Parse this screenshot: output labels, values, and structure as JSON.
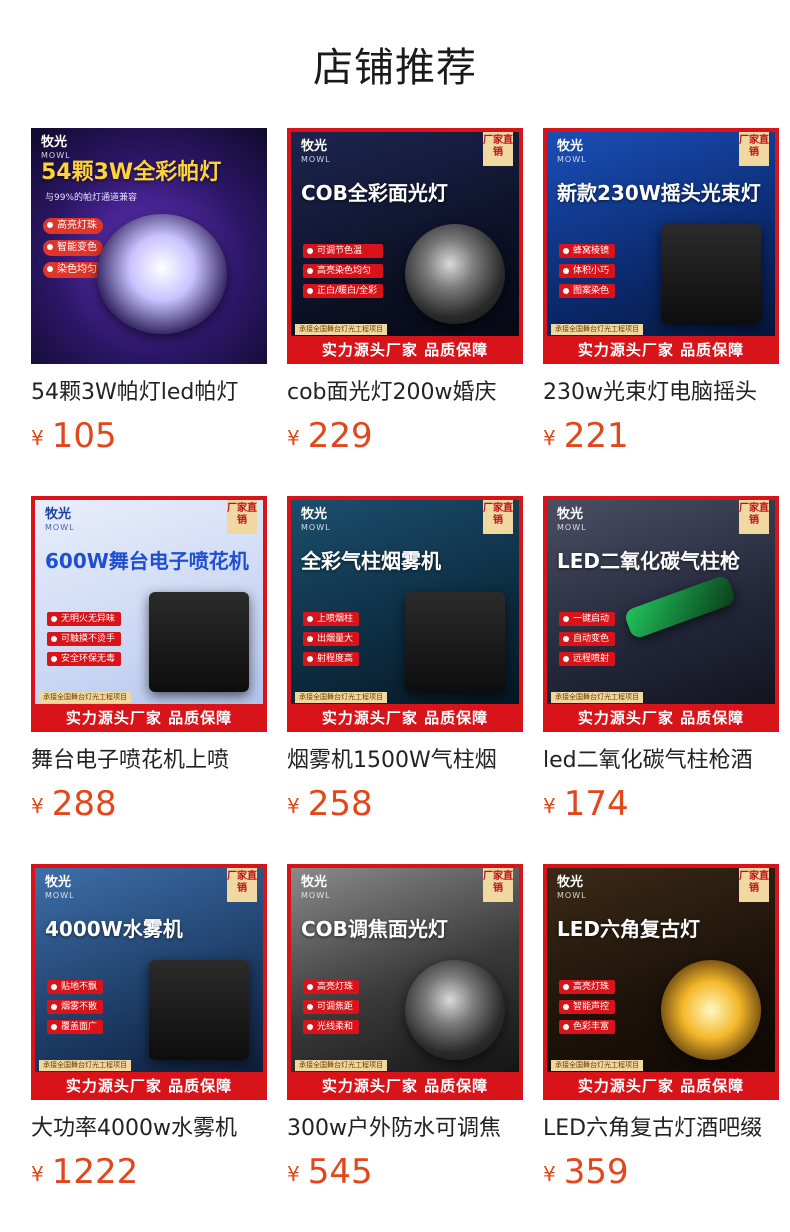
{
  "page": {
    "title": "店铺推荐"
  },
  "colors": {
    "price": "#e2471b",
    "brand_red": "#d8141a"
  },
  "products": [
    {
      "name": "54颗3W帕灯led帕灯",
      "currency": "¥",
      "price": "105",
      "image": {
        "logo": "牧光",
        "title": "54颗3W全彩帕灯",
        "subtitle": "与99%的帕灯通道兼容",
        "features": [
          "高亮灯珠",
          "智能变色",
          "染色均匀"
        ]
      }
    },
    {
      "name": "cob面光灯200w婚庆",
      "currency": "¥",
      "price": "229",
      "image": {
        "logo": "牧光",
        "tag": "厂家直销",
        "title": "COB全彩面光灯",
        "features": [
          "可调节色温",
          "高亮染色均匀",
          "正白/暖白/全彩"
        ],
        "strip_pre": "承接全国舞台灯光工程项目",
        "strip": "实力源头厂家 品质保障"
      }
    },
    {
      "name": "230w光束灯电脑摇头",
      "currency": "¥",
      "price": "221",
      "image": {
        "logo": "牧光",
        "tag": "厂家直销",
        "title": "新款230W摇头光束灯",
        "features": [
          "蜂窝棱镜",
          "体积小巧",
          "图案染色"
        ],
        "strip_pre": "承接全国舞台灯光工程项目",
        "strip": "实力源头厂家 品质保障"
      }
    },
    {
      "name": "舞台电子喷花机上喷",
      "currency": "¥",
      "price": "288",
      "image": {
        "logo": "牧光",
        "tag": "厂家直销",
        "title": "600W舞台电子喷花机",
        "features": [
          "无明火无异味",
          "可触摸不烫手",
          "安全环保无毒"
        ],
        "strip_pre": "承接全国舞台灯光工程项目",
        "strip": "实力源头厂家 品质保障"
      }
    },
    {
      "name": "烟雾机1500W气柱烟",
      "currency": "¥",
      "price": "258",
      "image": {
        "logo": "牧光",
        "tag": "厂家直销",
        "title": "全彩气柱烟雾机",
        "features": [
          "上喷烟柱",
          "出烟量大",
          "射程度高"
        ],
        "strip_pre": "承接全国舞台灯光工程项目",
        "strip": "实力源头厂家 品质保障"
      }
    },
    {
      "name": "led二氧化碳气柱枪酒",
      "currency": "¥",
      "price": "174",
      "image": {
        "logo": "牧光",
        "tag": "厂家直销",
        "title": "LED二氧化碳气柱枪",
        "features": [
          "一键启动",
          "自动变色",
          "远程喷射"
        ],
        "strip_pre": "承接全国舞台灯光工程项目",
        "strip": "实力源头厂家 品质保障"
      }
    },
    {
      "name": "大功率4000w水雾机",
      "currency": "¥",
      "price": "1222",
      "image": {
        "logo": "牧光",
        "tag": "厂家直销",
        "title": "4000W水雾机",
        "features": [
          "贴地不飘",
          "烟雾不散",
          "覆盖面广"
        ],
        "strip_pre": "承接全国舞台灯光工程项目",
        "strip": "实力源头厂家 品质保障"
      }
    },
    {
      "name": "300w户外防水可调焦",
      "currency": "¥",
      "price": "545",
      "image": {
        "logo": "牧光",
        "tag": "厂家直销",
        "title": "COB调焦面光灯",
        "features": [
          "高亮灯珠",
          "可调焦距",
          "光线柔和"
        ],
        "strip_pre": "承接全国舞台灯光工程项目",
        "strip": "实力源头厂家 品质保障"
      }
    },
    {
      "name": "LED六角复古灯酒吧缀",
      "currency": "¥",
      "price": "359",
      "image": {
        "logo": "牧光",
        "tag": "厂家直销",
        "title": "LED六角复古灯",
        "features": [
          "高亮灯珠",
          "智能声控",
          "色彩丰富"
        ],
        "strip_pre": "承接全国舞台灯光工程项目",
        "strip": "实力源头厂家 品质保障"
      }
    }
  ]
}
